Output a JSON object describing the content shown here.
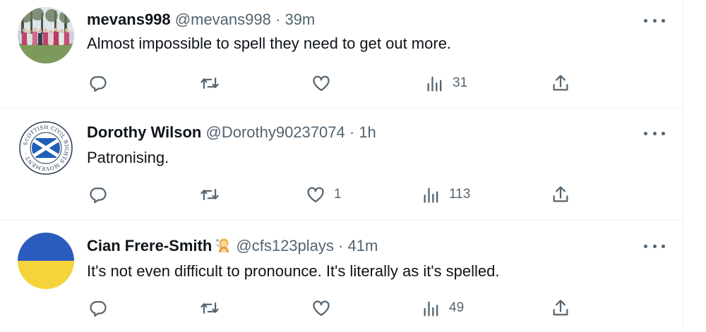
{
  "tweets": [
    {
      "name": "mevans998",
      "handle": "@mevans998",
      "separator": "·",
      "time": "39m",
      "text": "Almost impossible to spell they need to get out more.",
      "replies": "",
      "retweets": "",
      "likes": "",
      "views": "31"
    },
    {
      "name": "Dorothy Wilson",
      "handle": "@Dorothy90237074",
      "separator": "·",
      "time": "1h",
      "text": "Patronising.",
      "replies": "",
      "retweets": "",
      "likes": "1",
      "views": "113",
      "avatar_seal_text": "SCOTTISH CIVIL RIGHTS MOVEMENT"
    },
    {
      "name": "Cian Frere-Smith",
      "handle": "@cfs123plays",
      "separator": "·",
      "time": "41m",
      "text": "It's not even difficult to pronounce. It's literally as it's spelled.",
      "replies": "",
      "retweets": "",
      "likes": "",
      "views": "49",
      "name_emoji": "fairy-emoji"
    }
  ],
  "icons": {
    "reply": "reply-icon",
    "retweet": "retweet-icon",
    "like": "heart-icon",
    "views": "views-icon",
    "share": "share-icon",
    "more": "more-icon"
  },
  "colors": {
    "text": "#0f1419",
    "secondary": "#536471",
    "divider": "#eff3f4",
    "ukraine_blue": "#2a5bbf",
    "ukraine_yellow": "#f4d43a",
    "scotland_blue": "#1f5fb8"
  }
}
